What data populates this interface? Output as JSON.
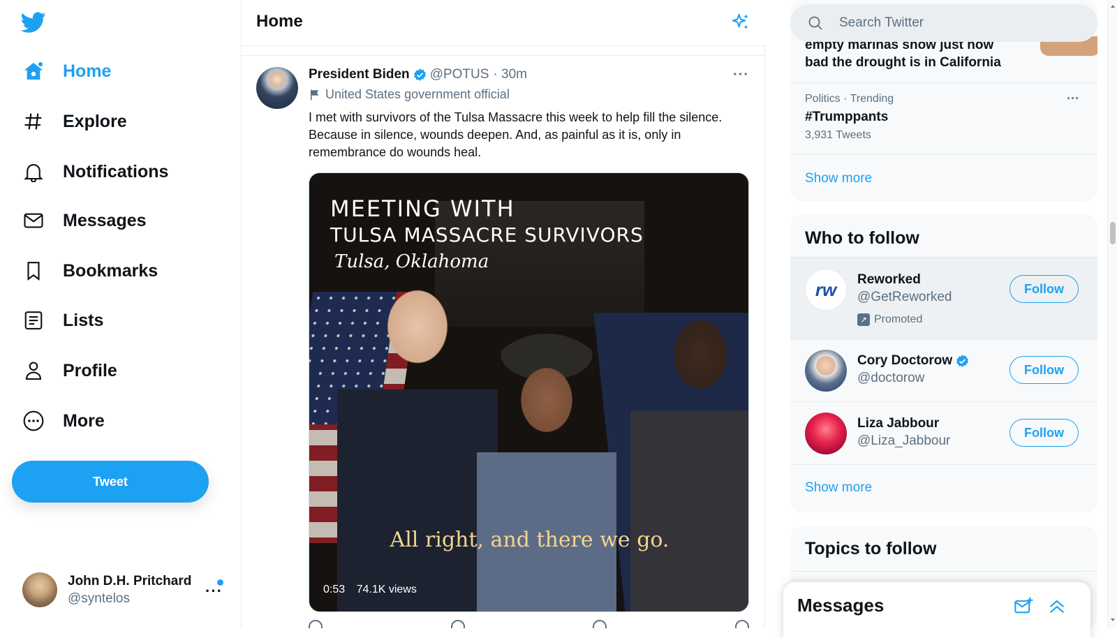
{
  "nav": {
    "items": [
      {
        "label": "Home",
        "icon": "home-icon",
        "active": true
      },
      {
        "label": "Explore",
        "icon": "hashtag-icon"
      },
      {
        "label": "Notifications",
        "icon": "bell-icon"
      },
      {
        "label": "Messages",
        "icon": "envelope-icon"
      },
      {
        "label": "Bookmarks",
        "icon": "bookmark-icon"
      },
      {
        "label": "Lists",
        "icon": "list-icon"
      },
      {
        "label": "Profile",
        "icon": "person-icon"
      },
      {
        "label": "More",
        "icon": "more-circle-icon"
      }
    ],
    "tweet_button": "Tweet",
    "account": {
      "name": "John D.H. Pritchard",
      "handle": "@syntelos"
    }
  },
  "main": {
    "title": "Home",
    "tweet": {
      "name": "President Biden",
      "handle": "@POTUS",
      "time": "· 30m",
      "label": "United States government official",
      "text": "I met with survivors of the Tulsa Massacre this week to help fill the silence. Because in silence, wounds deepen. And, as painful as it is, only in remembrance do wounds heal.",
      "media": {
        "overlay_line1": "MEETING WITH",
        "overlay_line2": "TULSA MASSACRE SURVIVORS",
        "overlay_line3": "Tulsa, Oklahoma",
        "caption": "All right, and there we go.",
        "duration": "0:53",
        "views": "74.1K views"
      }
    }
  },
  "right": {
    "search_placeholder": "Search Twitter",
    "trends": {
      "cut_off_title": "empty marinas show just how bad the drought is in California",
      "items": [
        {
          "context": "Politics · Trending",
          "title": "#Trumppants",
          "count": "3,931 Tweets"
        }
      ],
      "show_more": "Show more"
    },
    "who_to_follow": {
      "title": "Who to follow",
      "accounts": [
        {
          "name": "Reworked",
          "handle": "@GetReworked",
          "promoted": "Promoted",
          "avatar_text": "rw",
          "follow": "Follow"
        },
        {
          "name": "Cory Doctorow",
          "handle": "@doctorow",
          "verified": true,
          "follow": "Follow"
        },
        {
          "name": "Liza Jabbour",
          "handle": "@Liza_Jabbour",
          "follow": "Follow"
        }
      ],
      "show_more": "Show more"
    },
    "topics": {
      "title": "Topics to follow"
    },
    "messages_dock": {
      "title": "Messages"
    }
  },
  "colors": {
    "accent": "#1da1f2",
    "muted": "#5b7083",
    "border": "#e6ecf0",
    "panel_bg": "#f7f9fa"
  }
}
